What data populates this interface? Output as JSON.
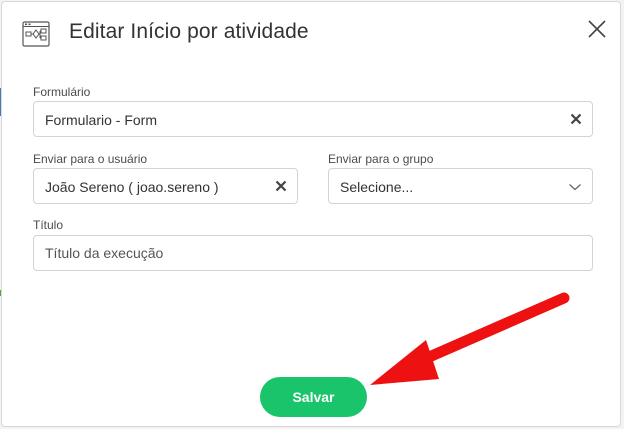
{
  "modal": {
    "title": "Editar Início por atividade"
  },
  "form": {
    "formulario": {
      "label": "Formulário",
      "value": "Formulario - Form"
    },
    "enviar_usuario": {
      "label": "Enviar para o usuário",
      "value": "João Sereno ( joao.sereno )"
    },
    "enviar_grupo": {
      "label": "Enviar para o grupo",
      "value": "Selecione..."
    },
    "titulo": {
      "label": "Título",
      "placeholder": "Título da execução"
    }
  },
  "actions": {
    "save_label": "Salvar"
  },
  "colors": {
    "save_button": "#19c46a",
    "annotation_arrow": "#ee1111"
  },
  "icons": {
    "header": "workflow-diagram-icon",
    "close": "close-icon",
    "clear": "clear-x-icon",
    "dropdown": "chevron-down-icon"
  }
}
